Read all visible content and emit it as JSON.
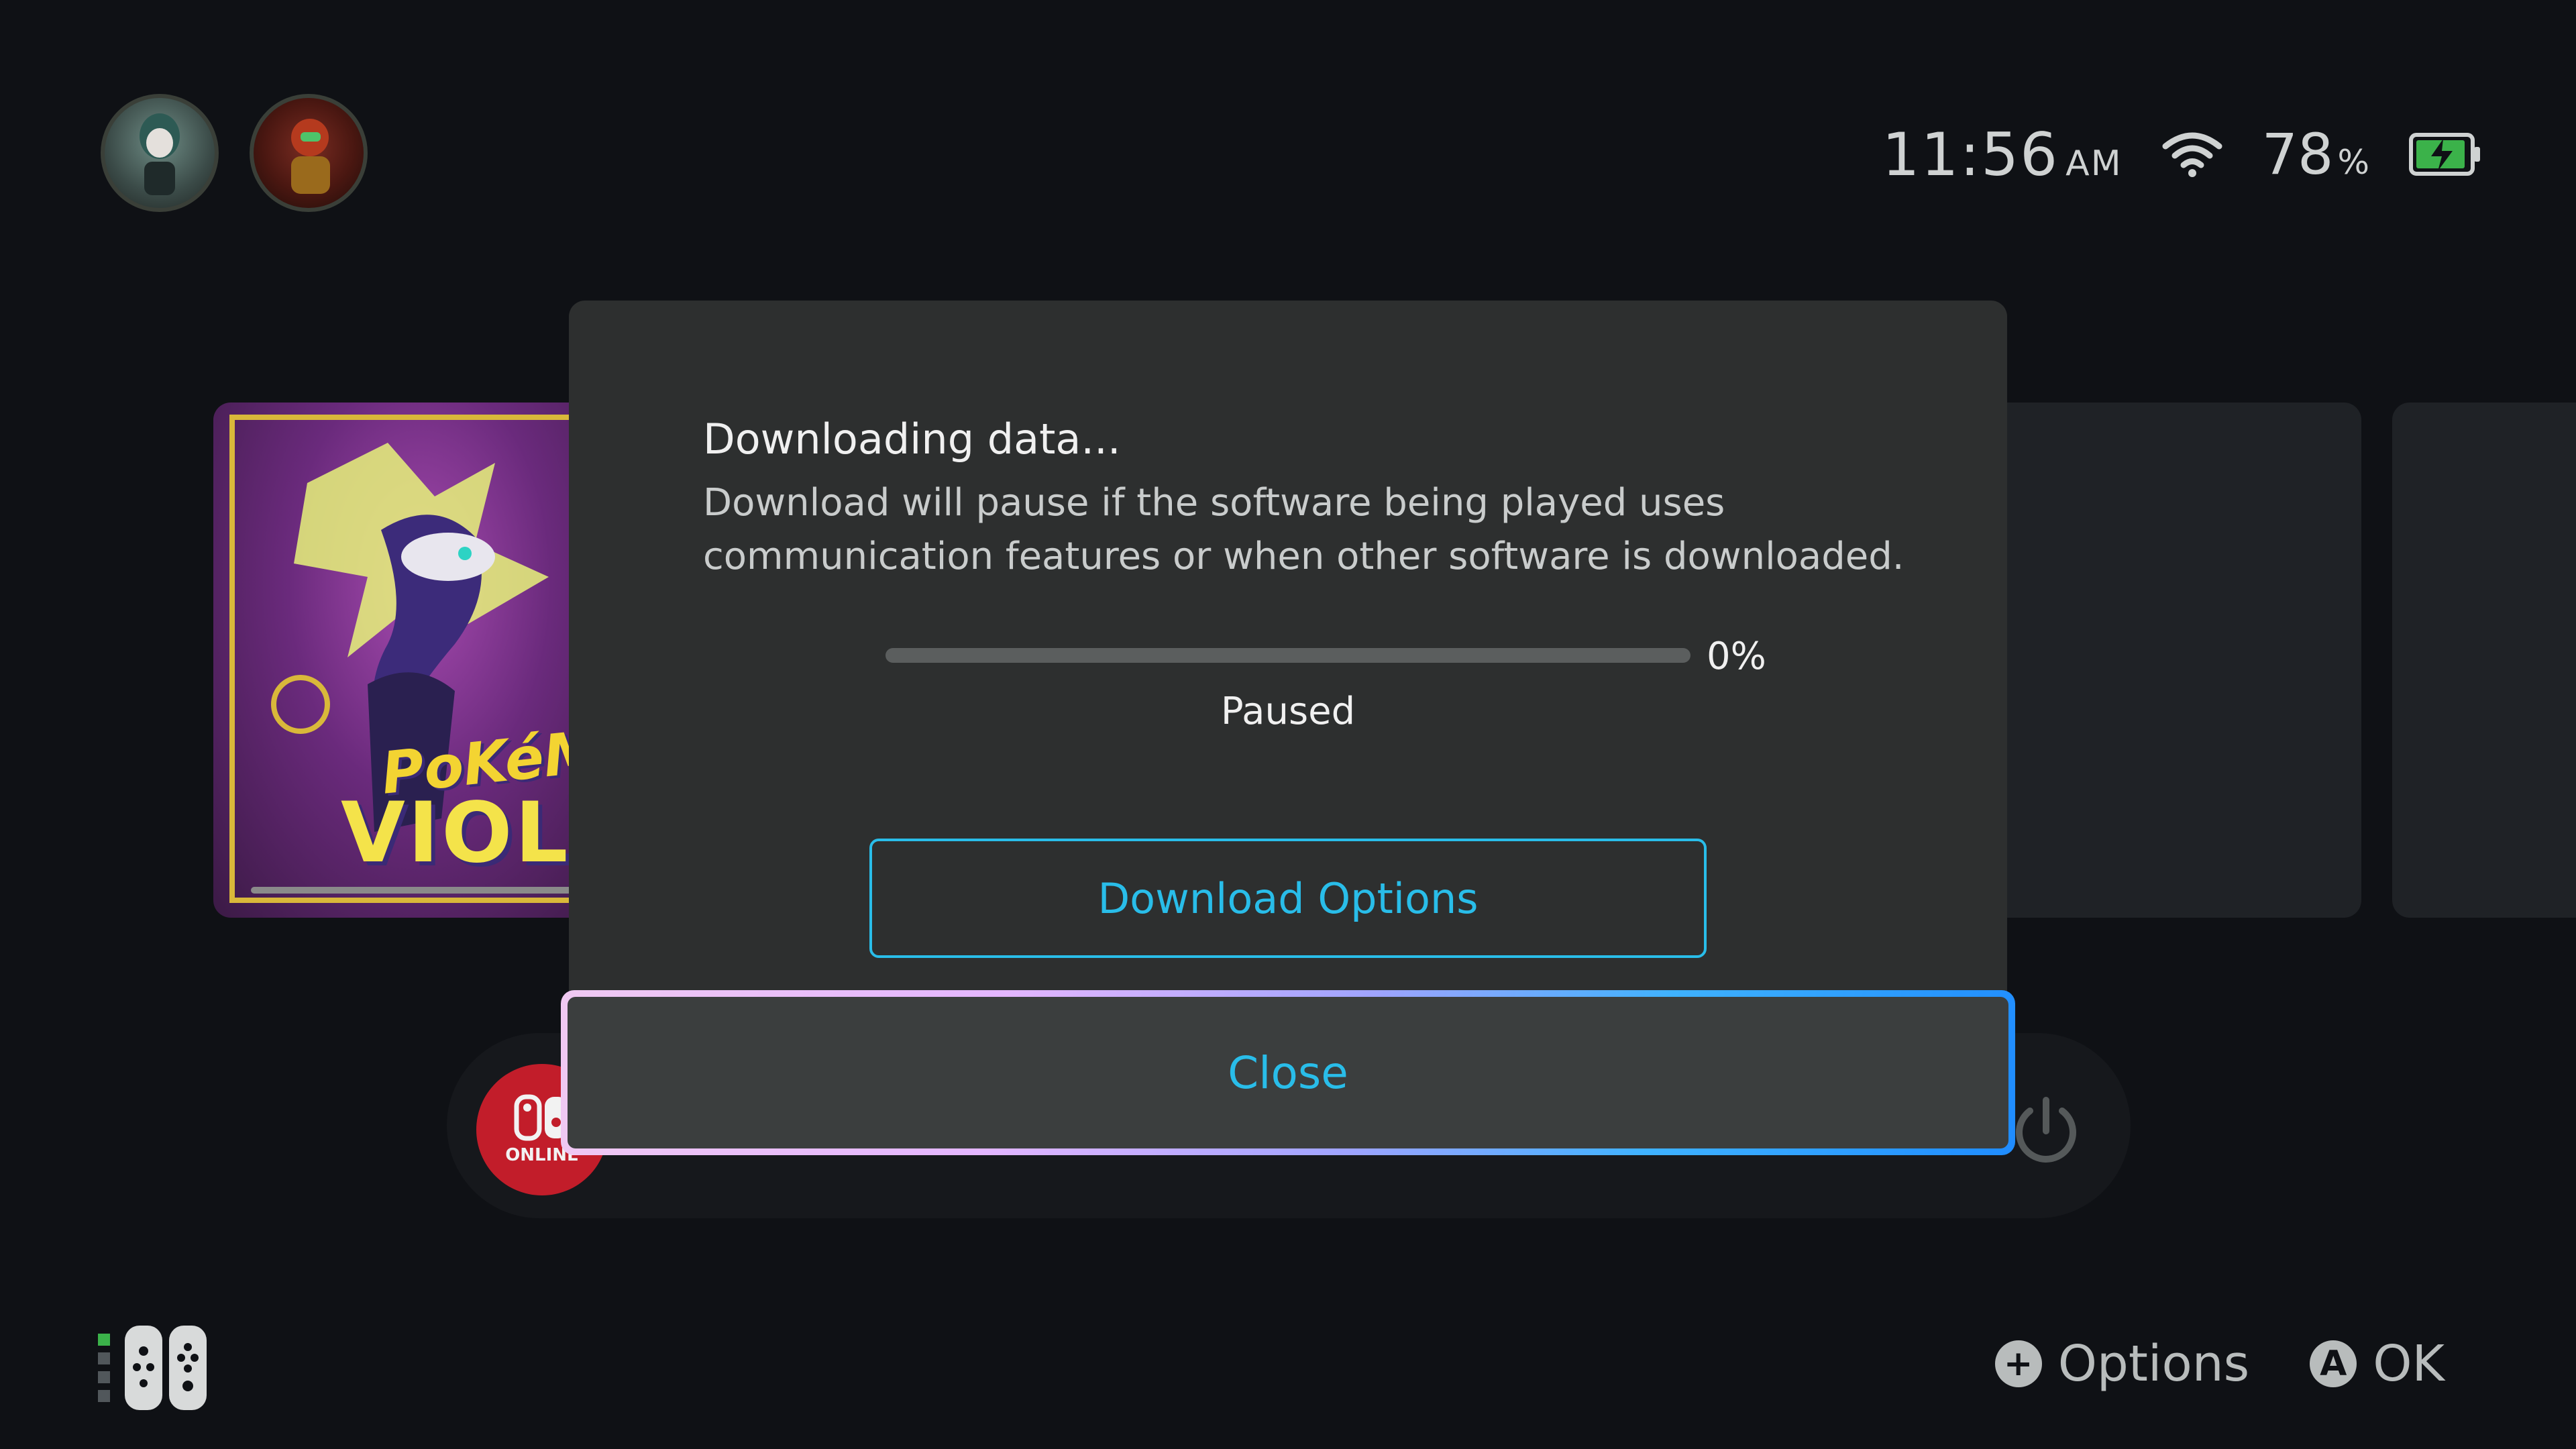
{
  "status": {
    "time": "11:56",
    "ampm": "AM",
    "battery": "78",
    "battery_unit": "%",
    "icons": [
      "wifi-icon",
      "battery-charging-icon"
    ]
  },
  "game": {
    "logo_line1": "PoKéMoN",
    "logo_line2": "VIOLET"
  },
  "dock": {
    "online_label": "ONLINE"
  },
  "dialog": {
    "title": "Downloading data...",
    "body": "Download will pause if the software being played uses communication features or when other software is downloaded.",
    "progress_percent": 0,
    "progress_label": "0%",
    "state": "Paused",
    "download_options_label": "Download Options",
    "close_label": "Close"
  },
  "hints": {
    "options_icon": "+",
    "options_label": "Options",
    "ok_icon": "A",
    "ok_label": "OK"
  },
  "colors": {
    "accent": "#29bde9",
    "focus_gradient_start": "#f0c9f2",
    "focus_gradient_end": "#1f8cff",
    "online_red": "#c21d2a"
  }
}
